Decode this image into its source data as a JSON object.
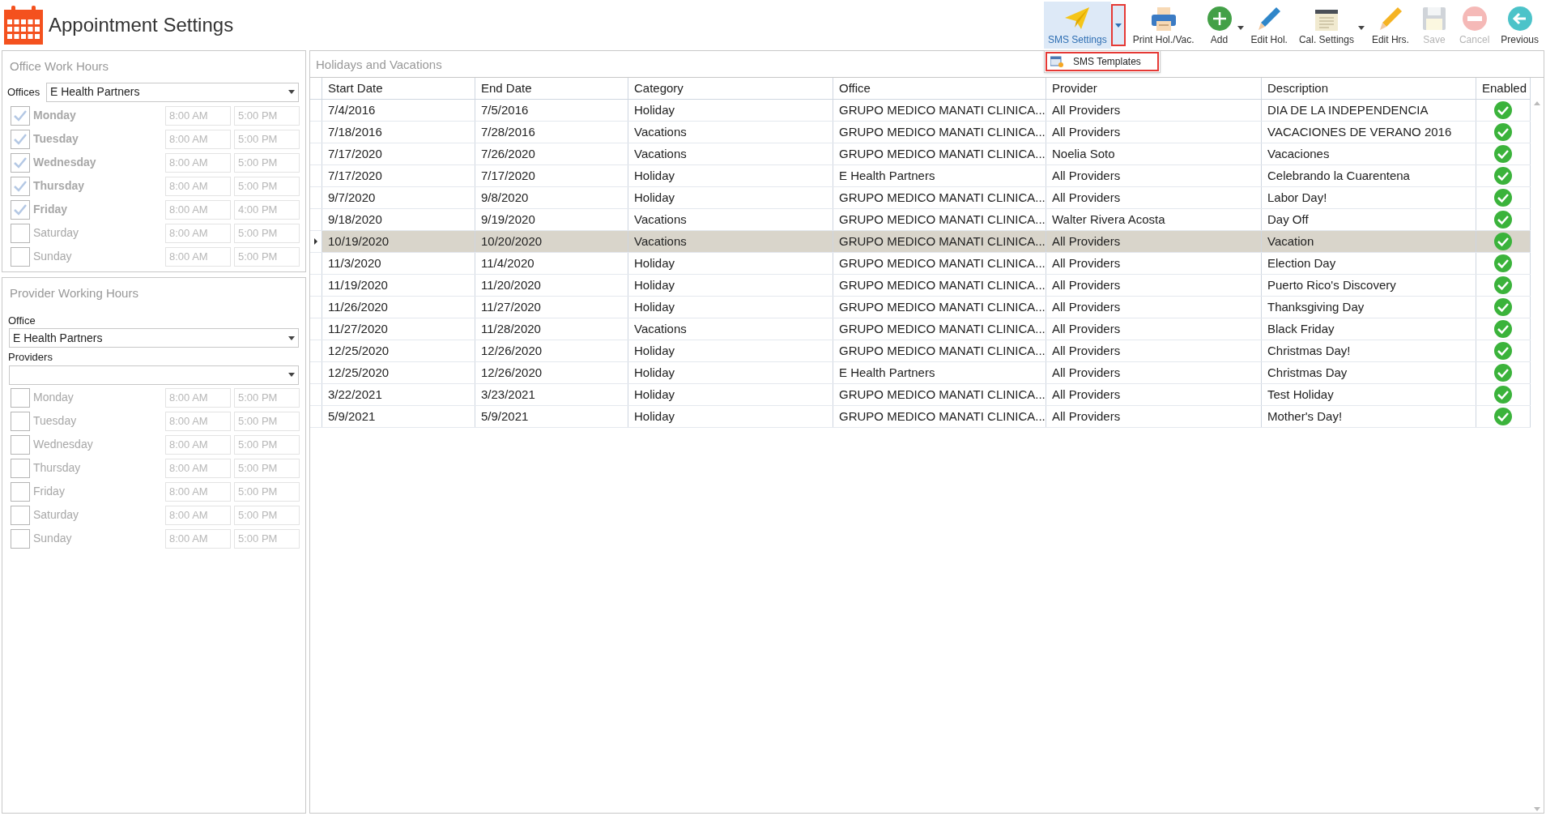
{
  "window": {
    "title": "Appointment Settings"
  },
  "toolbar": [
    {
      "kind": "sms",
      "label": "SMS Settings",
      "pressed": true,
      "disabled": false,
      "dropdown": true,
      "dropdown_highlighted": true
    },
    {
      "kind": "print",
      "label": "Print Hol./Vac.",
      "pressed": false,
      "disabled": false,
      "dropdown": false
    },
    {
      "kind": "add",
      "label": "Add",
      "pressed": false,
      "disabled": false,
      "dropdown": true
    },
    {
      "kind": "edit",
      "label": "Edit Hol.",
      "pressed": false,
      "disabled": false,
      "dropdown": false
    },
    {
      "kind": "calendar",
      "label": "Cal. Settings",
      "pressed": false,
      "disabled": false,
      "dropdown": true
    },
    {
      "kind": "pencil",
      "label": "Edit Hrs.",
      "pressed": false,
      "disabled": false,
      "dropdown": false
    },
    {
      "kind": "save",
      "label": "Save",
      "pressed": false,
      "disabled": true,
      "dropdown": false
    },
    {
      "kind": "cancel",
      "label": "Cancel",
      "pressed": false,
      "disabled": true,
      "dropdown": false
    },
    {
      "kind": "previous",
      "label": "Previous",
      "pressed": false,
      "disabled": false,
      "dropdown": false
    }
  ],
  "dropdown_menu": {
    "items": [
      {
        "label": "SMS Templates",
        "highlighted": true
      }
    ]
  },
  "office_work_hours": {
    "title": "Office Work Hours",
    "office_label": "Offices",
    "office_value": "E Health Partners",
    "days": [
      {
        "day": "Monday",
        "checked": true,
        "start": "8:00 AM",
        "end": "5:00 PM"
      },
      {
        "day": "Tuesday",
        "checked": true,
        "start": "8:00 AM",
        "end": "5:00 PM"
      },
      {
        "day": "Wednesday",
        "checked": true,
        "start": "8:00 AM",
        "end": "5:00 PM"
      },
      {
        "day": "Thursday",
        "checked": true,
        "start": "8:00 AM",
        "end": "5:00 PM"
      },
      {
        "day": "Friday",
        "checked": true,
        "start": "8:00 AM",
        "end": "4:00 PM"
      },
      {
        "day": "Saturday",
        "checked": false,
        "start": "8:00 AM",
        "end": "5:00 PM"
      },
      {
        "day": "Sunday",
        "checked": false,
        "start": "8:00 AM",
        "end": "5:00 PM"
      }
    ]
  },
  "provider_working_hours": {
    "title": "Provider Working Hours",
    "office_label": "Office",
    "office_value": "E Health Partners",
    "providers_label": "Providers",
    "days": [
      {
        "day": "Monday",
        "checked": false,
        "start": "8:00 AM",
        "end": "5:00 PM"
      },
      {
        "day": "Tuesday",
        "checked": false,
        "start": "8:00 AM",
        "end": "5:00 PM"
      },
      {
        "day": "Wednesday",
        "checked": false,
        "start": "8:00 AM",
        "end": "5:00 PM"
      },
      {
        "day": "Thursday",
        "checked": false,
        "start": "8:00 AM",
        "end": "5:00 PM"
      },
      {
        "day": "Friday",
        "checked": false,
        "start": "8:00 AM",
        "end": "5:00 PM"
      },
      {
        "day": "Saturday",
        "checked": false,
        "start": "8:00 AM",
        "end": "5:00 PM"
      },
      {
        "day": "Sunday",
        "checked": false,
        "start": "8:00 AM",
        "end": "5:00 PM"
      }
    ]
  },
  "holidays": {
    "title": "Holidays and Vacations",
    "columns": [
      "Start Date",
      "End Date",
      "Category",
      "Office",
      "Provider",
      "Description",
      "Enabled"
    ],
    "rows": [
      {
        "cells": [
          "7/4/2016",
          "7/5/2016",
          "Holiday",
          "GRUPO MEDICO MANATI CLINICA...",
          "All Providers",
          "DIA DE LA INDEPENDENCIA"
        ],
        "enabled": true,
        "selected": false
      },
      {
        "cells": [
          "7/18/2016",
          "7/28/2016",
          "Vacations",
          "GRUPO MEDICO MANATI CLINICA...",
          "All Providers",
          "VACACIONES DE VERANO 2016"
        ],
        "enabled": true,
        "selected": false
      },
      {
        "cells": [
          "7/17/2020",
          "7/26/2020",
          "Vacations",
          "GRUPO MEDICO MANATI CLINICA...",
          "Noelia Soto",
          "Vacaciones"
        ],
        "enabled": true,
        "selected": false
      },
      {
        "cells": [
          "7/17/2020",
          "7/17/2020",
          "Holiday",
          "E Health Partners",
          "All Providers",
          "Celebrando la Cuarentena"
        ],
        "enabled": true,
        "selected": false
      },
      {
        "cells": [
          "9/7/2020",
          "9/8/2020",
          "Holiday",
          "GRUPO MEDICO MANATI CLINICA...",
          "All Providers",
          "Labor Day!"
        ],
        "enabled": true,
        "selected": false
      },
      {
        "cells": [
          "9/18/2020",
          "9/19/2020",
          "Vacations",
          "GRUPO MEDICO MANATI CLINICA...",
          "Walter Rivera Acosta",
          "Day Off"
        ],
        "enabled": true,
        "selected": false
      },
      {
        "cells": [
          "10/19/2020",
          "10/20/2020",
          "Vacations",
          "GRUPO MEDICO MANATI CLINICA...",
          "All Providers",
          "Vacation"
        ],
        "enabled": true,
        "selected": true
      },
      {
        "cells": [
          "11/3/2020",
          "11/4/2020",
          "Holiday",
          "GRUPO MEDICO MANATI CLINICA...",
          "All Providers",
          "Election Day"
        ],
        "enabled": true,
        "selected": false
      },
      {
        "cells": [
          "11/19/2020",
          "11/20/2020",
          "Holiday",
          "GRUPO MEDICO MANATI CLINICA...",
          "All Providers",
          "Puerto Rico's Discovery"
        ],
        "enabled": true,
        "selected": false
      },
      {
        "cells": [
          "11/26/2020",
          "11/27/2020",
          "Holiday",
          "GRUPO MEDICO MANATI CLINICA...",
          "All Providers",
          "Thanksgiving Day"
        ],
        "enabled": true,
        "selected": false
      },
      {
        "cells": [
          "11/27/2020",
          "11/28/2020",
          "Vacations",
          "GRUPO MEDICO MANATI CLINICA...",
          "All Providers",
          "Black Friday"
        ],
        "enabled": true,
        "selected": false
      },
      {
        "cells": [
          "12/25/2020",
          "12/26/2020",
          "Holiday",
          "GRUPO MEDICO MANATI CLINICA...",
          "All Providers",
          "Christmas Day!"
        ],
        "enabled": true,
        "selected": false
      },
      {
        "cells": [
          "12/25/2020",
          "12/26/2020",
          "Holiday",
          "E Health Partners",
          "All Providers",
          "Christmas Day"
        ],
        "enabled": true,
        "selected": false
      },
      {
        "cells": [
          "3/22/2021",
          "3/23/2021",
          "Holiday",
          "GRUPO MEDICO MANATI CLINICA...",
          "All Providers",
          "Test Holiday"
        ],
        "enabled": true,
        "selected": false
      },
      {
        "cells": [
          "5/9/2021",
          "5/9/2021",
          "Holiday",
          "GRUPO MEDICO MANATI CLINICA...",
          "All Providers",
          "Mother's Day!"
        ],
        "enabled": true,
        "selected": false
      }
    ]
  }
}
